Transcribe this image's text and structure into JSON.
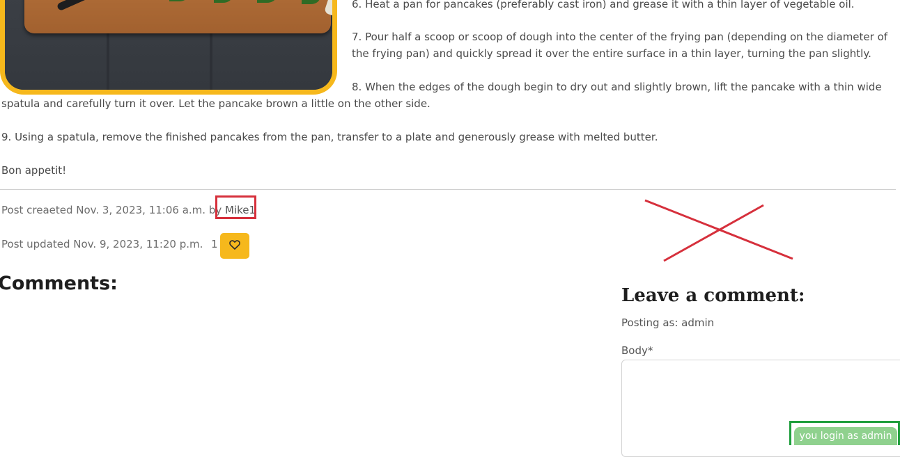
{
  "recipe": {
    "step6": "6. Heat a pan for pancakes (preferably cast iron) and grease it with a thin layer of vegetable oil.",
    "step7_line1": "7. Pour half a scoop or scoop of dough into the center of the frying pan (depending on the diameter of",
    "step7_line2": "the frying pan) and quickly spread it over the entire surface in a thin layer, turning the pan slightly.",
    "step8_line1": "8. When the edges of the dough begin to dry out and slightly brown, lift the pancake with a thin wide",
    "step8_line2": "spatula and carefully turn it over. Let the pancake brown a little on the other side.",
    "step9": "9. Using a spatula, remove the finished pancakes from the pan, transfer to a plate and generously grease with melted butter.",
    "closing": "Bon appetit!"
  },
  "post_meta": {
    "created_prefix": "Post creaeted Nov. 3, 2023, 11:06 a.m. by",
    "author": "Mike1",
    "updated": "Post updated Nov. 9, 2023, 11:20 p.m.",
    "likes": "1",
    "like_icon": "heart-icon"
  },
  "comments": {
    "title": "Comments:"
  },
  "comment_form": {
    "title": "Leave a comment:",
    "posting_as": "Posting as: admin",
    "body_label": "Body*",
    "body_value": ""
  },
  "admin_badge": "you login as admin",
  "colors": {
    "accent": "#f6b81c",
    "annotation_red": "#d6303c",
    "annotation_green": "#1e9e3c",
    "badge": "#8fd18e"
  }
}
